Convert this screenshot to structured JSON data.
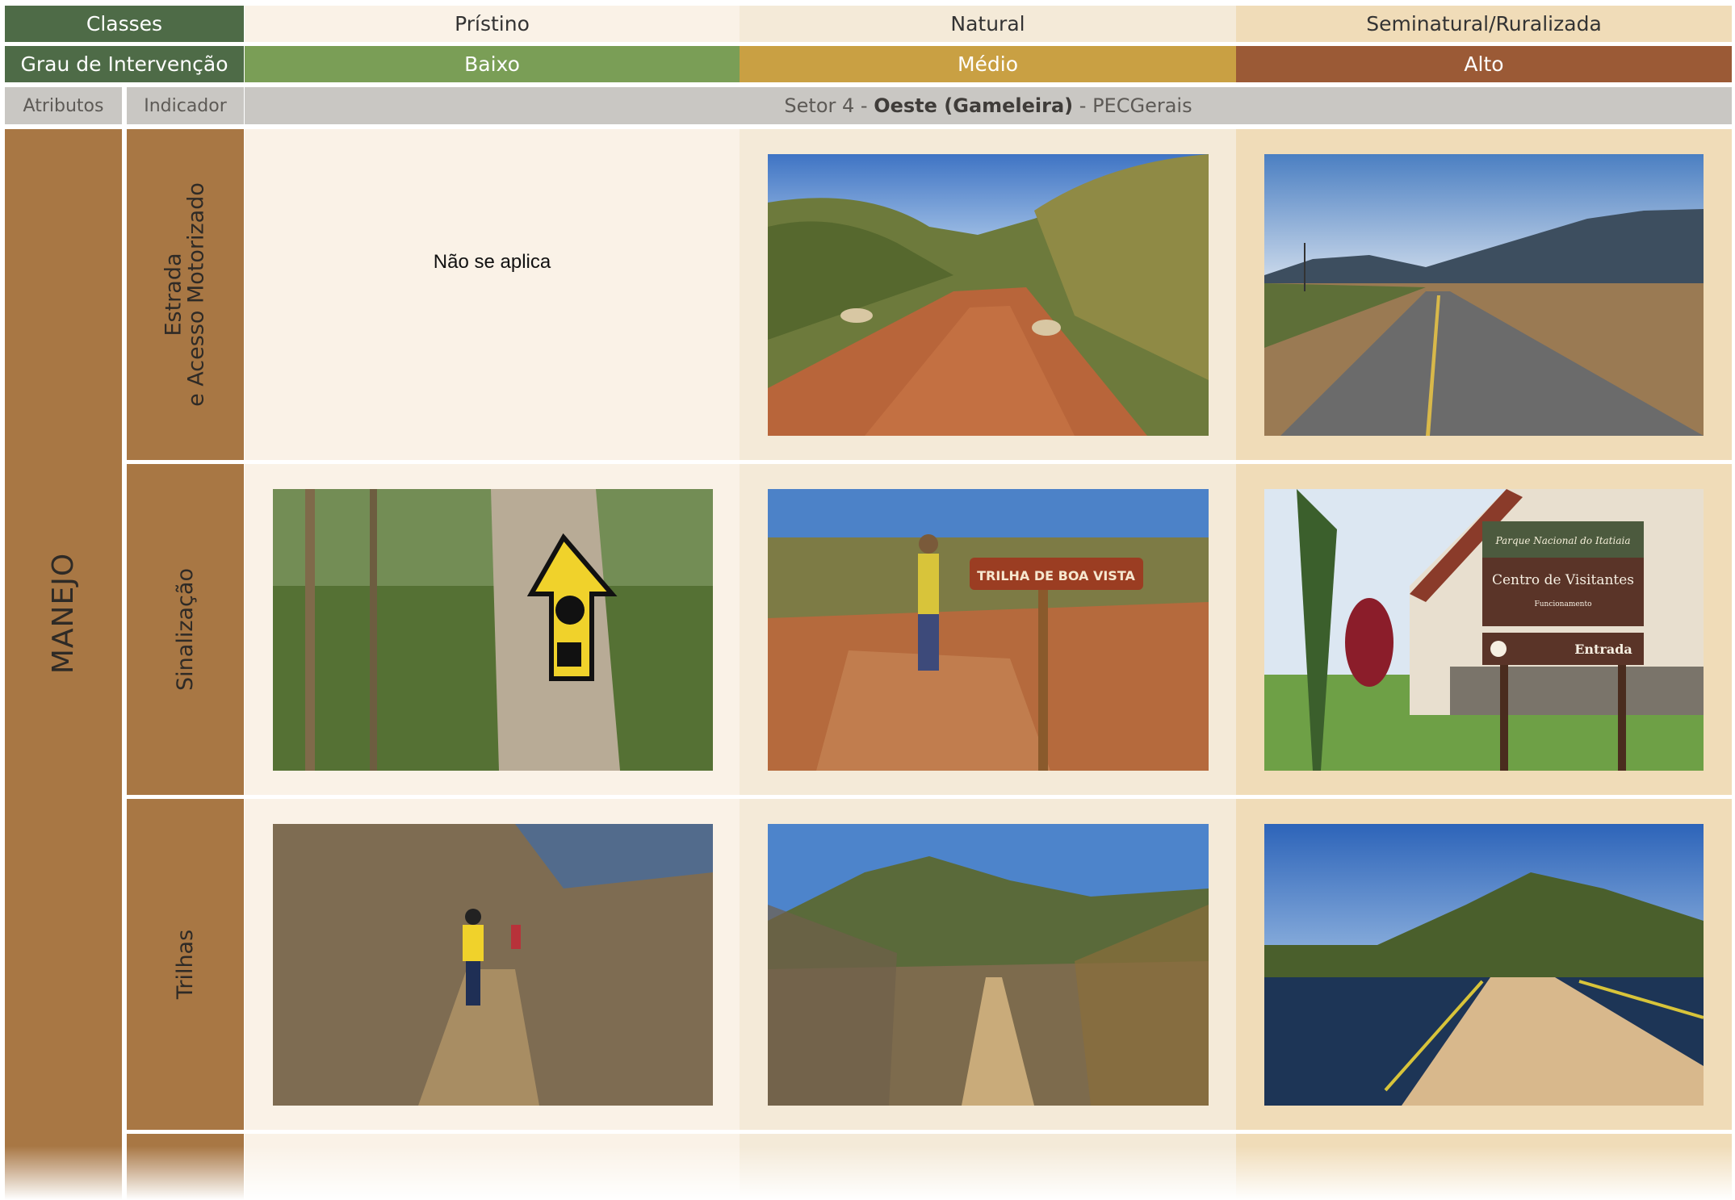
{
  "header": {
    "classes_label": "Classes",
    "class_names": [
      "Prístino",
      "Natural",
      "Seminatural/Ruralizada"
    ],
    "grau_label": "Grau de Intervenção",
    "levels": [
      "Baixo",
      "Médio",
      "Alto"
    ],
    "atributos_label": "Atributos",
    "indicador_label": "Indicador",
    "sector": {
      "prefix": "Setor 4 - ",
      "bold": "Oeste (Gameleira)",
      "suffix": " - PECGerais"
    }
  },
  "attribute": "MANEJO",
  "indicators": {
    "row1_line1": "Estrada",
    "row1_line2": "e Acesso Motorizado",
    "row2": "Sinalização",
    "row3": "Trilhas"
  },
  "cells": {
    "not_applicable": "Não se aplica"
  },
  "photos": {
    "r1_natural": "dirt-road-photo",
    "r1_seminatural": "paved-road-photo",
    "r2_pristino": "painted-trail-marker-photo",
    "r2_natural": "wooden-sign-photo",
    "r2_seminatural": "visitor-center-sign-photo",
    "r3_pristino": "hikers-on-trail-photo",
    "r3_natural": "mountain-trail-photo",
    "r3_seminatural": "dam-walkway-photo"
  },
  "sign_texts": {
    "trail_sign": "TRILHA DE BOA VISTA",
    "park_name": "Parque Nacional do Itatiaia",
    "center": "Centro de Visitantes",
    "hours": "Funcionamento",
    "entrance": "Entrada"
  },
  "colors": {
    "classes_green": "#4e6b47",
    "baixo": "#7a9e56",
    "medio": "#c9a043",
    "alto": "#9b5a36",
    "manejo_brown": "#a87744",
    "pristino_bg": "#faf2e7",
    "natural_bg": "#f4ead8",
    "seminatural_bg": "#f0dcb8"
  }
}
